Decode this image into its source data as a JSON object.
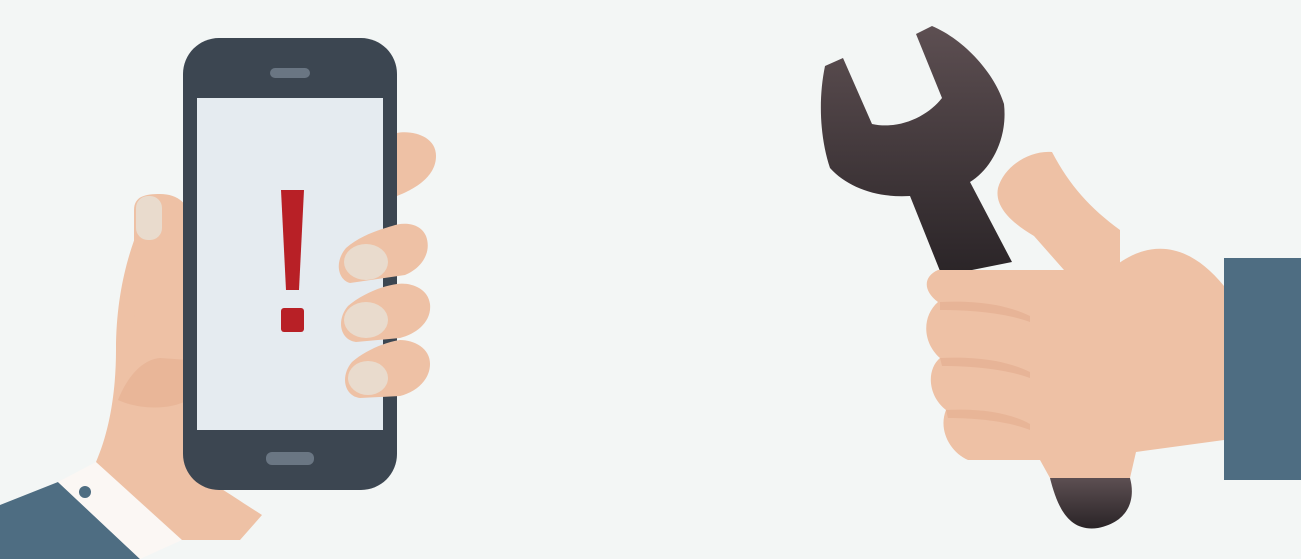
{
  "illustration": {
    "left_group": "hand-holding-phone",
    "right_group": "hand-holding-wrench",
    "phone_screen_icon": "exclamation-icon"
  },
  "colors": {
    "background": "#f3f6f5",
    "skin": "#eec1a5",
    "skin_shadow": "#e3ab8c",
    "nail": "#e9dbcd",
    "phone_body": "#3c4651",
    "phone_screen": "#e5ebf0",
    "phone_button": "#6a7683",
    "alert_red": "#b82026",
    "sleeve_blue": "#4e6d82",
    "cuff_white": "#fbf7f4",
    "wrench_top": "#5d4f52",
    "wrench_bottom": "#2a2427"
  }
}
